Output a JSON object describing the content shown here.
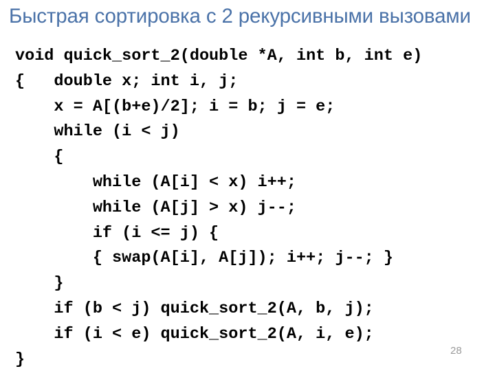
{
  "slide": {
    "title": "Быстрая сортировка с 2 рекурсивными вызовами",
    "title_color": "#4a72a8",
    "background_color": "#ffffff",
    "number": "28",
    "number_color": "#9a9a9a",
    "code_color": "#000000",
    "code": {
      "language": "C",
      "lines": [
        "void quick_sort_2(double *A, int b, int e)",
        "{   double x; int i, j;",
        "    x = A[(b+e)/2]; i = b; j = e;",
        "    while (i < j)",
        "    {",
        "        while (A[i] < x) i++;",
        "        while (A[j] > x) j--;",
        "        if (i <= j) {",
        "        { swap(A[i], A[j]); i++; j--; }",
        "    }",
        "    if (b < j) quick_sort_2(A, b, j);",
        "    if (i < e) quick_sort_2(A, i, e);",
        "}"
      ]
    }
  }
}
